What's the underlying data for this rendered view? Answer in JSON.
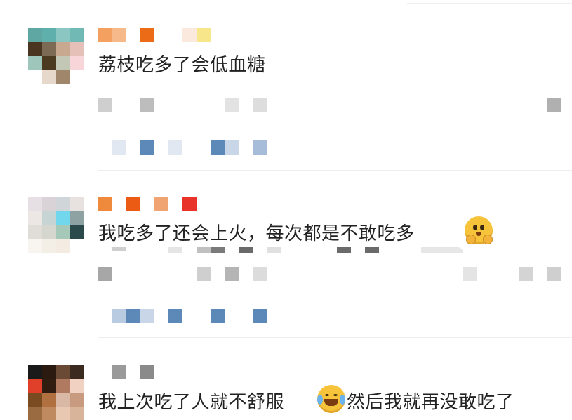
{
  "comments": [
    {
      "text": "荔枝吃多了会低血糖",
      "avatar_colors": [
        "#5fa7a2",
        "#5fb0ac",
        "#8cc6c3",
        "#4a3520",
        "#7c6a55",
        "#e4c0b8",
        "#9fc6bb",
        "#4c3a20",
        "#f8d5d9",
        "#e6d9cc",
        "#a0866a",
        "#ffffff"
      ],
      "name_colors": [
        "#f3a060",
        "#ec6b16",
        "#fbe3cf",
        "#f7e78a"
      ]
    },
    {
      "text": "我吃多了还会上火，每次都是不敢吃多",
      "emoji": "hug-face-emoji-icon",
      "avatar_colors": [
        "#d9d2d6",
        "#cfd5d8",
        "#e7e1df",
        "#70d7ec",
        "#8ea2a4",
        "#e0ddd8",
        "#a5c8b9",
        "#2a4a4c",
        "#f3eee6",
        "#f4ece2"
      ],
      "name_colors": [
        "#ef8a3c",
        "#ec5b13",
        "#f0a472",
        "#e8332a"
      ]
    },
    {
      "text": "我上次吃了人就不舒服",
      "text_after": "然后我就再没敢吃了",
      "emoji": "laugh-cry-emoji-icon",
      "avatar_colors": [
        "#1a1a1a",
        "#6a4a35",
        "#2a1a10",
        "#e0402a",
        "#301c10",
        "#b07a60",
        "#f1d2c2",
        "#7a4a20",
        "#b07040",
        "#d9b9a6"
      ],
      "name_colors": [
        "#9a9a9a",
        "#8a8a8a"
      ]
    }
  ],
  "colors": {
    "text": "#222222",
    "action_blue": "#5d89b8",
    "action_light": "#cfd9e8",
    "gray_pixel": "#a7a7a7",
    "divider": "#eeeeee"
  }
}
